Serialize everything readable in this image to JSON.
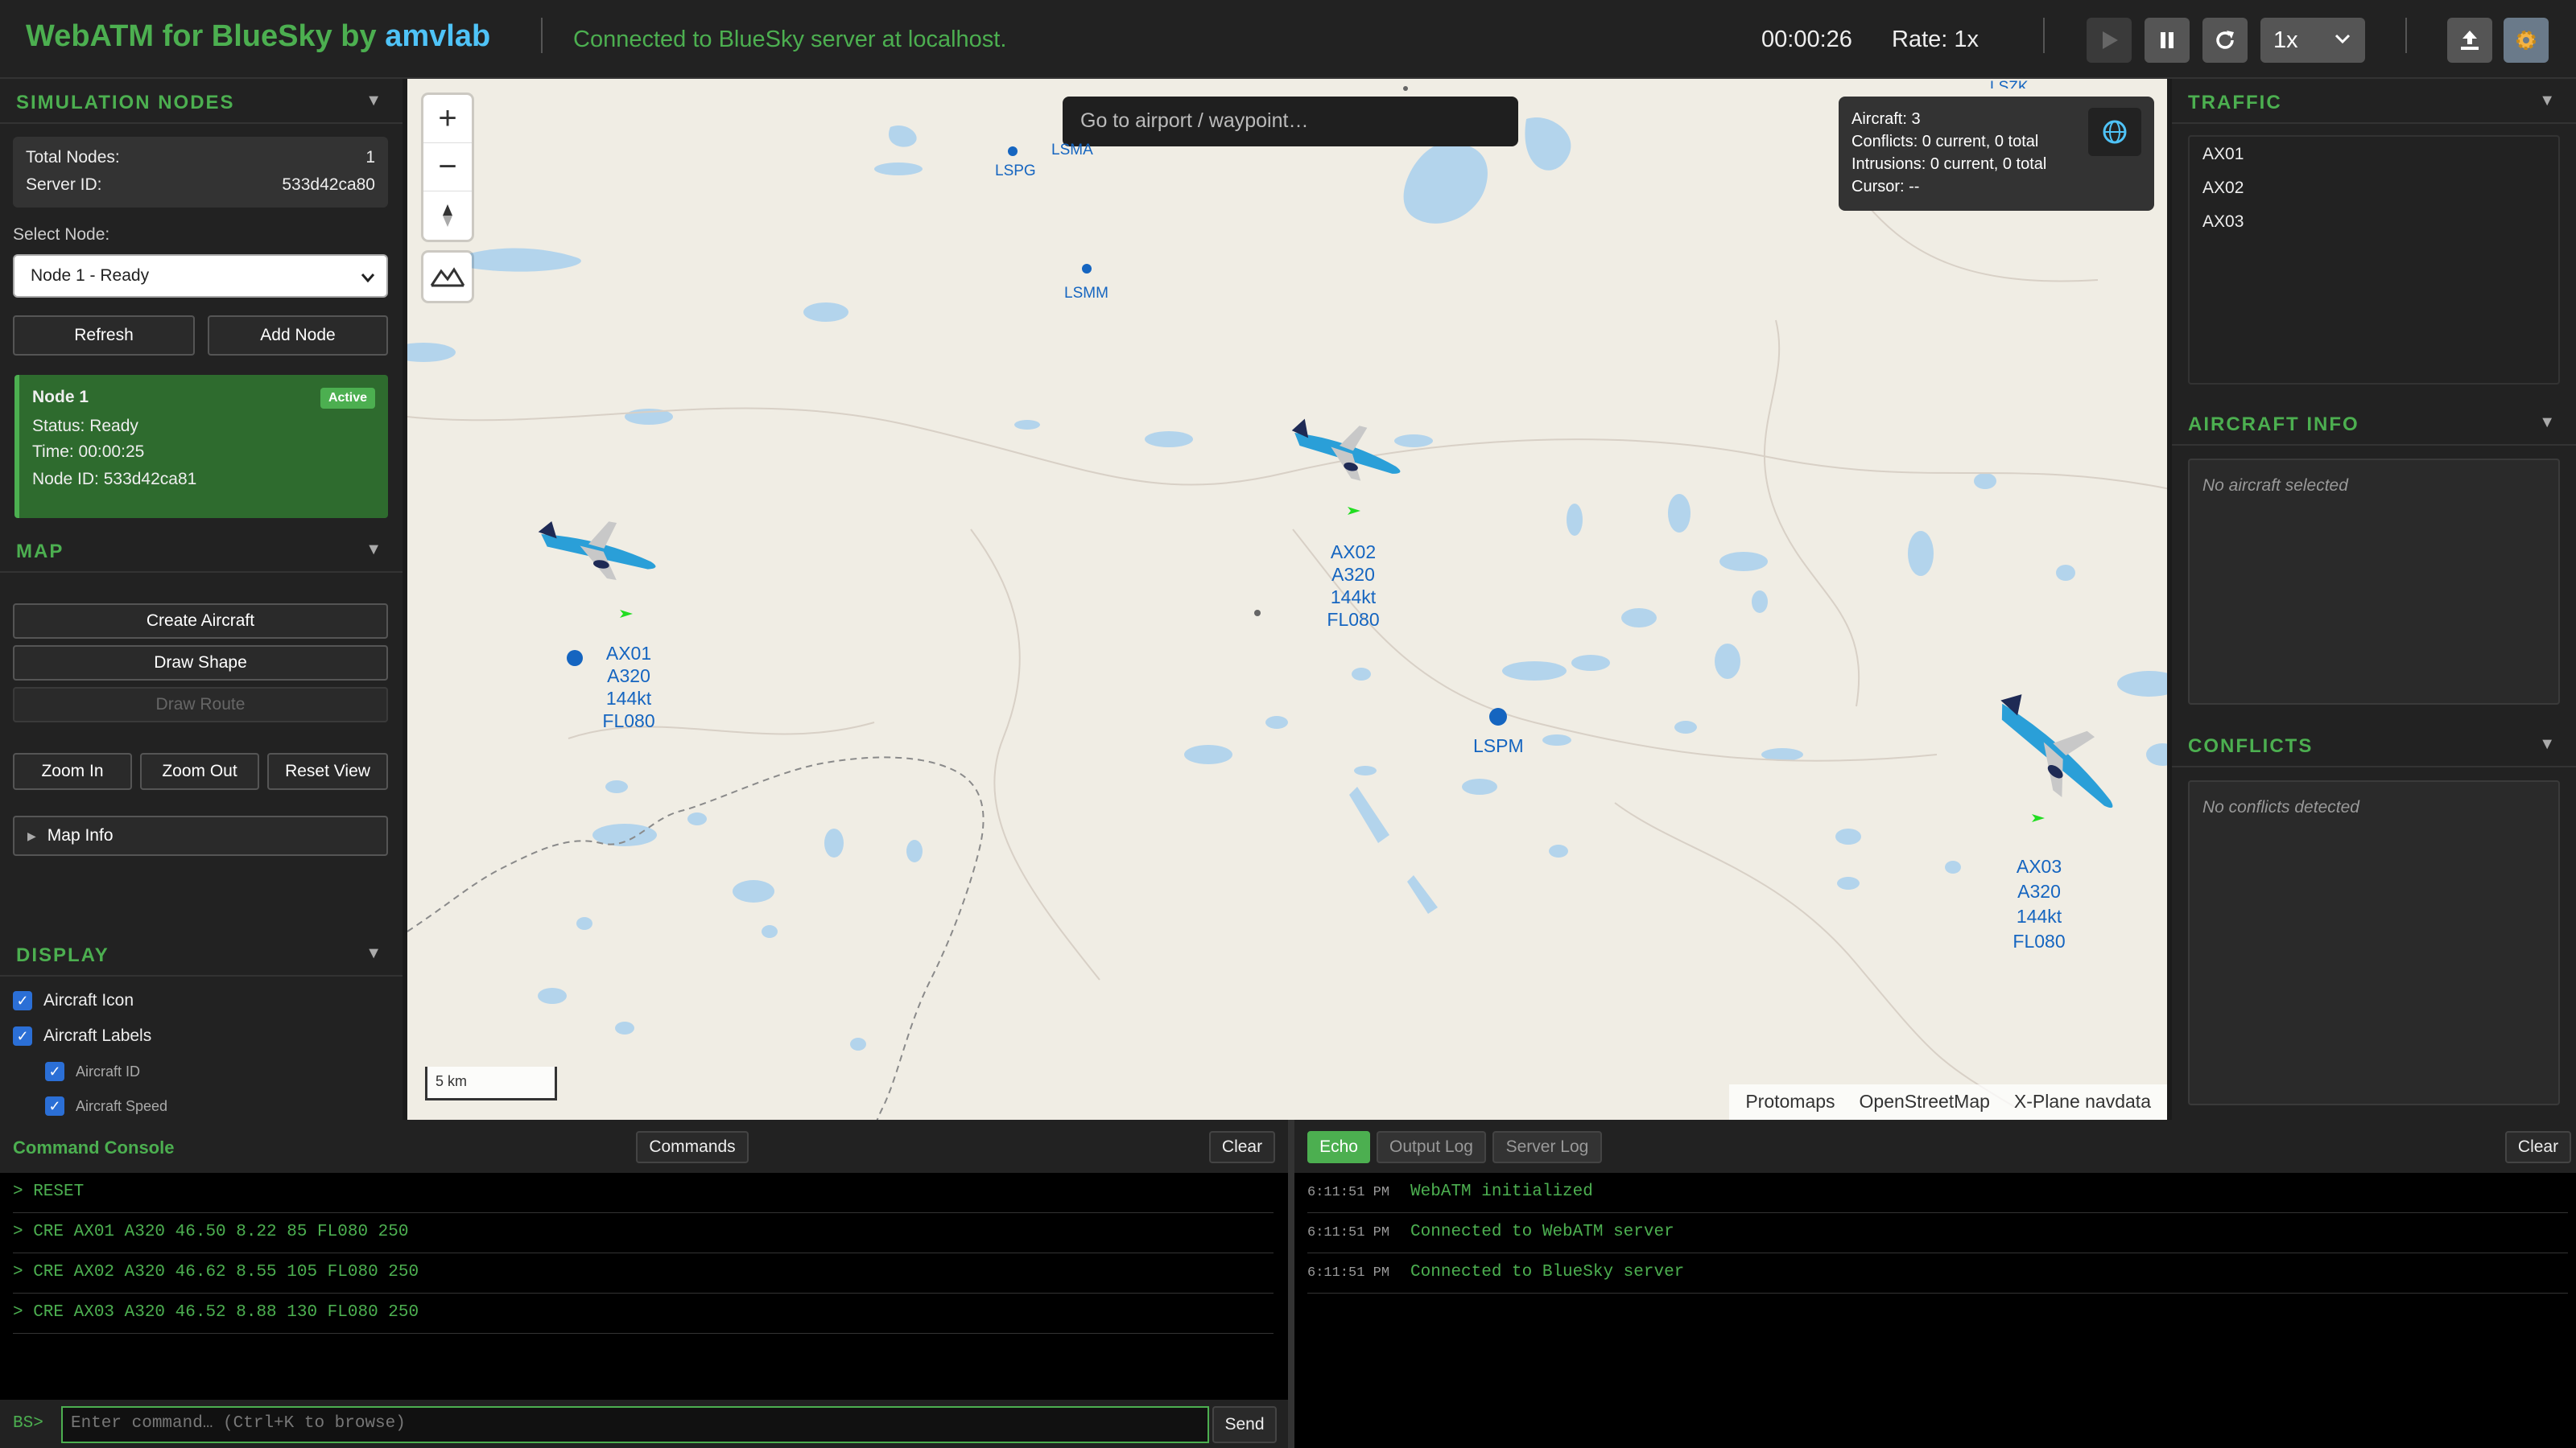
{
  "header": {
    "brand_prefix": "WebATM for BlueSky by",
    "brand_suffix": "amvlab",
    "connection": "Connected to BlueSky server at localhost.",
    "sim_time": "00:00:26",
    "rate": "Rate: 1x",
    "speed": "1x"
  },
  "left": {
    "sim_nodes": {
      "title": "SIMULATION NODES",
      "total_label": "Total Nodes:",
      "total_value": "1",
      "server_label": "Server ID:",
      "server_value": "533d42ca80",
      "select_label": "Select Node:",
      "selected": "Node 1 - Ready",
      "refresh": "Refresh",
      "add": "Add Node",
      "card": {
        "name": "Node 1",
        "badge": "Active",
        "status": "Status: Ready",
        "time": "Time: 00:00:25",
        "node_id": "Node ID: 533d42ca81"
      }
    },
    "map": {
      "title": "MAP",
      "create": "Create Aircraft",
      "draw_shape": "Draw Shape",
      "draw_route": "Draw Route",
      "zoom_in": "Zoom In",
      "zoom_out": "Zoom Out",
      "reset": "Reset View",
      "info": "Map Info"
    },
    "display": {
      "title": "DISPLAY",
      "items": [
        "Aircraft Icon",
        "Aircraft Labels"
      ],
      "sub_items": [
        "Aircraft ID",
        "Aircraft Speed"
      ]
    }
  },
  "map": {
    "search_placeholder": "Go to airport / waypoint…",
    "stats": {
      "aircraft": "Aircraft: 3",
      "conflicts": "Conflicts: 0 current, 0 total",
      "intrusions": "Intrusions: 0 current, 0 total",
      "cursor": "Cursor: --"
    },
    "airports": [
      "LSPG",
      "LSMA",
      "LSMM",
      "LSPM",
      "LSZK"
    ],
    "aircraft": [
      {
        "id": "AX01",
        "type": "A320",
        "speed": "144kt",
        "fl": "FL080"
      },
      {
        "id": "AX02",
        "type": "A320",
        "speed": "144kt",
        "fl": "FL080"
      },
      {
        "id": "AX03",
        "type": "A320",
        "speed": "144kt",
        "fl": "FL080"
      }
    ],
    "scale": "5 km",
    "attribution": [
      "Protomaps",
      "OpenStreetMap",
      "X-Plane navdata"
    ],
    "colors": {
      "land": "#f0ede4",
      "water": "#b3d4ec",
      "airport": "#1565c0",
      "aircraft_body": "#2a9fd8"
    }
  },
  "right": {
    "traffic": {
      "title": "TRAFFIC",
      "items": [
        "AX01",
        "AX02",
        "AX03"
      ]
    },
    "aircraft_info": {
      "title": "AIRCRAFT INFO",
      "placeholder": "No aircraft selected"
    },
    "conflicts": {
      "title": "CONFLICTS",
      "placeholder": "No conflicts detected"
    }
  },
  "console": {
    "title": "Command Console",
    "commands_btn": "Commands",
    "clear": "Clear",
    "lines": [
      "> RESET",
      "> CRE AX01 A320 46.50 8.22 85 FL080 250",
      "> CRE AX02 A320 46.62 8.55 105 FL080 250",
      "> CRE AX03 A320 46.52 8.88 130 FL080 250"
    ],
    "prompt": "BS>",
    "placeholder": "Enter command… (Ctrl+K to browse)",
    "send": "Send"
  },
  "log": {
    "tabs": [
      "Echo",
      "Output Log",
      "Server Log"
    ],
    "clear": "Clear",
    "entries": [
      {
        "time": "6:11:51 PM",
        "msg": "WebATM initialized"
      },
      {
        "time": "6:11:51 PM",
        "msg": "Connected to WebATM server"
      },
      {
        "time": "6:11:51 PM",
        "msg": "Connected to BlueSky server"
      }
    ]
  }
}
